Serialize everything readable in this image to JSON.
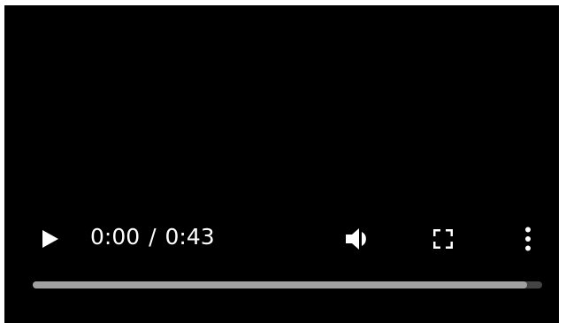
{
  "player": {
    "current_time": "0:00",
    "separator": "/",
    "duration": "0:43",
    "buffered_fraction": 0.97
  },
  "icons": {
    "play": "play-icon",
    "volume": "volume-icon",
    "fullscreen": "fullscreen-icon",
    "menu": "more-vertical-icon"
  },
  "colors": {
    "background": "#000000",
    "foreground": "#ffffff",
    "track": "#444444",
    "buffered": "#a0a0a0"
  }
}
